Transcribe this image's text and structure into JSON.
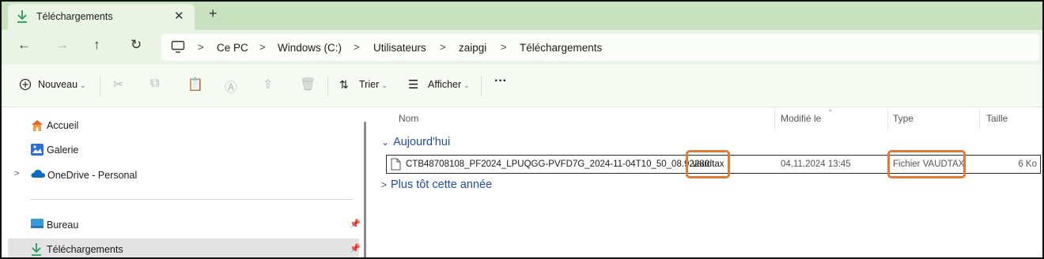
{
  "tab": {
    "title": "Téléchargements",
    "close_icon": "close-icon",
    "new_tab_label": "+"
  },
  "nav": {
    "back_icon": "←",
    "forward_icon": "→",
    "up_icon": "↑",
    "refresh_icon": "↻",
    "breadcrumbs": [
      "Ce PC",
      "Windows (C:)",
      "Utilisateurs",
      "zaipgi",
      "Téléchargements"
    ],
    "separator": ">"
  },
  "toolbar": {
    "new_label": "Nouveau",
    "sort_label": "Trier",
    "view_label": "Afficher",
    "more_label": "···",
    "caret": "⌄"
  },
  "sidebar": {
    "items": [
      {
        "label": "Accueil",
        "icon": "home-icon"
      },
      {
        "label": "Galerie",
        "icon": "gallery-icon"
      },
      {
        "label": "OneDrive - Personal",
        "icon": "onedrive-cloud-icon",
        "expand": ">"
      },
      {
        "label": "Bureau",
        "icon": "desktop-folder-icon",
        "pin": "📌"
      },
      {
        "label": "Téléchargements",
        "icon": "download-icon",
        "pin": "📌",
        "selected": true
      }
    ]
  },
  "table": {
    "columns": [
      "Nom",
      "Modifié le",
      "Type",
      "Taille"
    ],
    "groups": [
      {
        "label": "Aujourd'hui",
        "chevron": "⌄"
      },
      {
        "label": "Plus tôt cette année",
        "chevron": ">"
      }
    ],
    "rows": [
      {
        "name": "CTB48708108_PF2024_LPUQGG-PVFD7G_2024-11-04T10_50_08.92280",
        "extension": ".vaudtax",
        "modified": "04.11.2024 13:45",
        "type": "Fichier VAUDTAX",
        "size": "6 Ko"
      }
    ]
  },
  "colors": {
    "tab_bar": "#c9e2c0",
    "nav_bar": "#e9f4e4",
    "group_header": "#1f4fa3",
    "highlight": "#e07a35",
    "download_green": "#1e9e5a"
  }
}
